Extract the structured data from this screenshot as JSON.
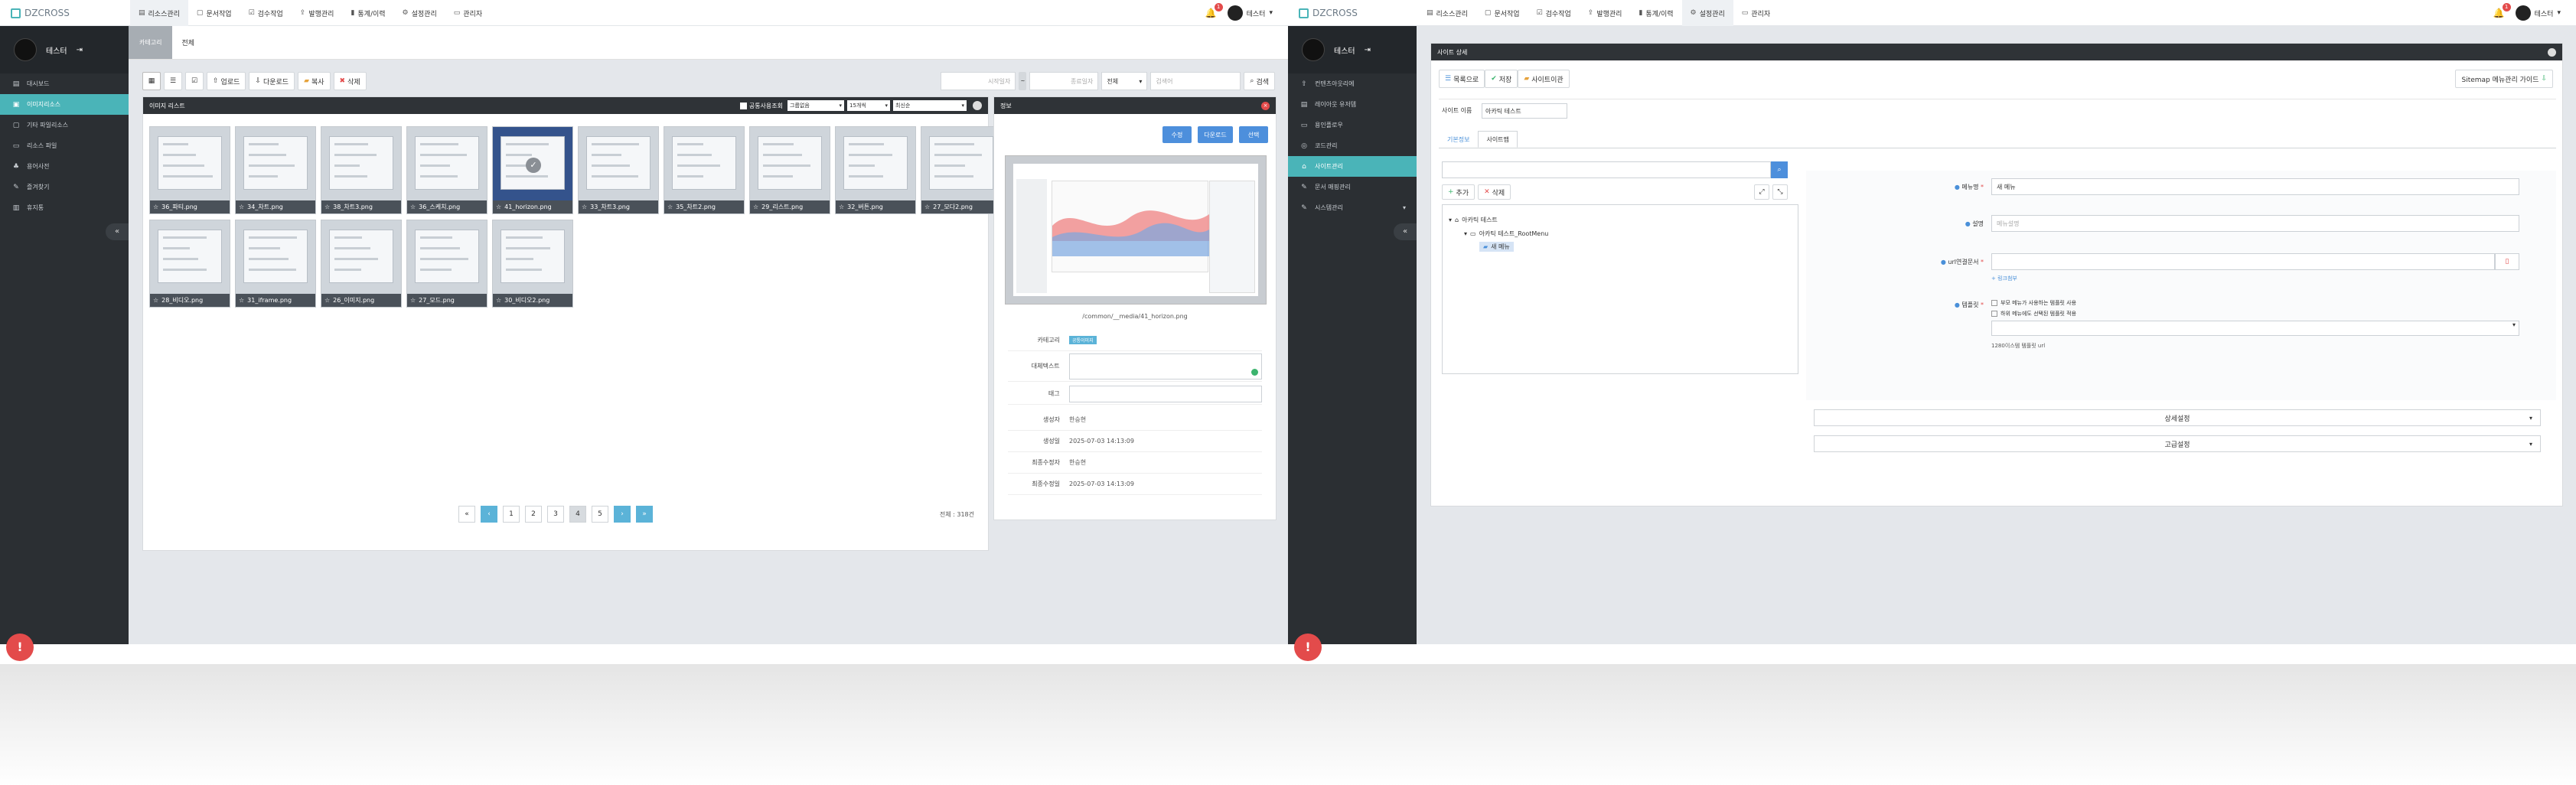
{
  "left": {
    "logo": "DZCROSS",
    "top_menu": [
      {
        "icon": "db-icon",
        "label": "리소스관리"
      },
      {
        "icon": "doc-icon",
        "label": "문서작업"
      },
      {
        "icon": "check-icon",
        "label": "검수작업"
      },
      {
        "icon": "deploy-icon",
        "label": "발행관리"
      },
      {
        "icon": "chart-icon",
        "label": "통계/이력"
      },
      {
        "icon": "gear-icon",
        "label": "설정관리"
      },
      {
        "icon": "monitor-icon",
        "label": "관리자"
      }
    ],
    "notification_count": "1",
    "user_name": "테스터",
    "side_user": "테스터",
    "side_menu": [
      {
        "label": "대시보드",
        "active": false
      },
      {
        "label": "이미지리소스",
        "active": true
      },
      {
        "label": "기타 파일리소스",
        "active": false
      },
      {
        "label": "리소스 파일",
        "active": false
      },
      {
        "label": "용어사전",
        "active": false
      },
      {
        "label": "즐겨찾기",
        "active": false
      },
      {
        "label": "휴지통",
        "active": false
      }
    ],
    "fab": "!",
    "breadcrumb": {
      "parent": "카테고리",
      "current": "전체"
    },
    "toolbar": {
      "upload": "업로드",
      "download": "다운로드",
      "move": "복사",
      "delete": "삭제",
      "start_date_ph": "시작일자",
      "end_date_ph": "종료일자",
      "filter": "전체",
      "search_ph": "검색어",
      "search_btn": "검색"
    },
    "list_panel": {
      "title": "이미지 리스트",
      "shared_toggle": "공통사용조회",
      "group_select": "그룹없음",
      "count_select": "15개씩",
      "sort_select": "최신순"
    },
    "images": [
      "36_파티.png",
      "34_차트.png",
      "38_차트3.png",
      "36_스케치.png",
      "41_horizon.png",
      "33_차트3.png",
      "35_차트2.png",
      "29_리스트.png",
      "32_버튼.png",
      "27_모다2.png",
      "28_비디오.png",
      "31_iframe.png",
      "26_이미지.png",
      "27_모드.png",
      "30_비디오2.png"
    ],
    "selected_index": 4,
    "pager": [
      "1",
      "2",
      "3",
      "4",
      "5"
    ],
    "pager_current": "4",
    "total": "전체 : 318건",
    "info_panel": {
      "title": "정보",
      "btn_edit": "수정",
      "btn_replace": "다운로드",
      "btn_select": "선택",
      "filename": "/common/__media/41_horizon.png",
      "rows": [
        {
          "k": "카테고리",
          "v": "공통이미지"
        },
        {
          "k": "대체텍스트",
          "v": ""
        },
        {
          "k": "태그",
          "v": ""
        },
        {
          "k": "생성자",
          "v": "한승현"
        },
        {
          "k": "생성일",
          "v": "2025-07-03 14:13:09"
        },
        {
          "k": "최종수정자",
          "v": "한승현"
        },
        {
          "k": "최종수정일",
          "v": "2025-07-03 14:13:09"
        }
      ]
    }
  },
  "right": {
    "logo": "DZCROSS",
    "top_menu": [
      {
        "icon": "db-icon",
        "label": "리소스관리"
      },
      {
        "icon": "doc-icon",
        "label": "문서작업"
      },
      {
        "icon": "check-icon",
        "label": "검수작업"
      },
      {
        "icon": "deploy-icon",
        "label": "발행관리"
      },
      {
        "icon": "chart-icon",
        "label": "통계/이력"
      },
      {
        "icon": "gear-icon",
        "label": "설정관리"
      },
      {
        "icon": "monitor-icon",
        "label": "관리자"
      }
    ],
    "notification_count": "1",
    "user_name": "테스터",
    "side_user": "테스터",
    "side_menu": [
      {
        "label": "컨텐츠아웃리에",
        "active": false
      },
      {
        "label": "레이아웃 유저템",
        "active": false
      },
      {
        "label": "용인플로우",
        "active": false
      },
      {
        "label": "코드관리",
        "active": false
      },
      {
        "label": "사이트관리",
        "active": true
      },
      {
        "label": "문서 매핑관리",
        "active": false
      },
      {
        "label": "시스템관리",
        "active": false
      }
    ],
    "fab": "!",
    "panel_title": "사이트 상세",
    "btn_list": "목록으로",
    "btn_save": "저장",
    "btn_history": "사이트이관",
    "btn_guide": "Sitemap 메뉴관리 가이드",
    "site_name_label": "사이트 이름",
    "site_name_value": "아카틱 테스트",
    "tabs": [
      "기본정보",
      "사이트맵"
    ],
    "tree_add": "추가",
    "tree_delete": "삭제",
    "tree": {
      "root": "아카틱 테스트",
      "child": "아카틱 테스트_RootMenu",
      "leaf": "새 메뉴"
    },
    "form": {
      "menu_name_label": "메뉴명",
      "menu_name_value": "새 메뉴",
      "desc_label": "설명",
      "desc_ph": "메뉴설명",
      "url_label": "url연결문서",
      "url_link": "+ 링크첨부",
      "template_label": "템플릿",
      "template_opt1": "부모 메뉴가 사용하는 템플릿 사용",
      "template_opt2": "하위 메뉴에도 선택된 템플릿 적용",
      "template_url": "1280이스템 템플릿 url"
    },
    "detail_settings": "상세설정",
    "advanced_settings": "고급설정"
  }
}
